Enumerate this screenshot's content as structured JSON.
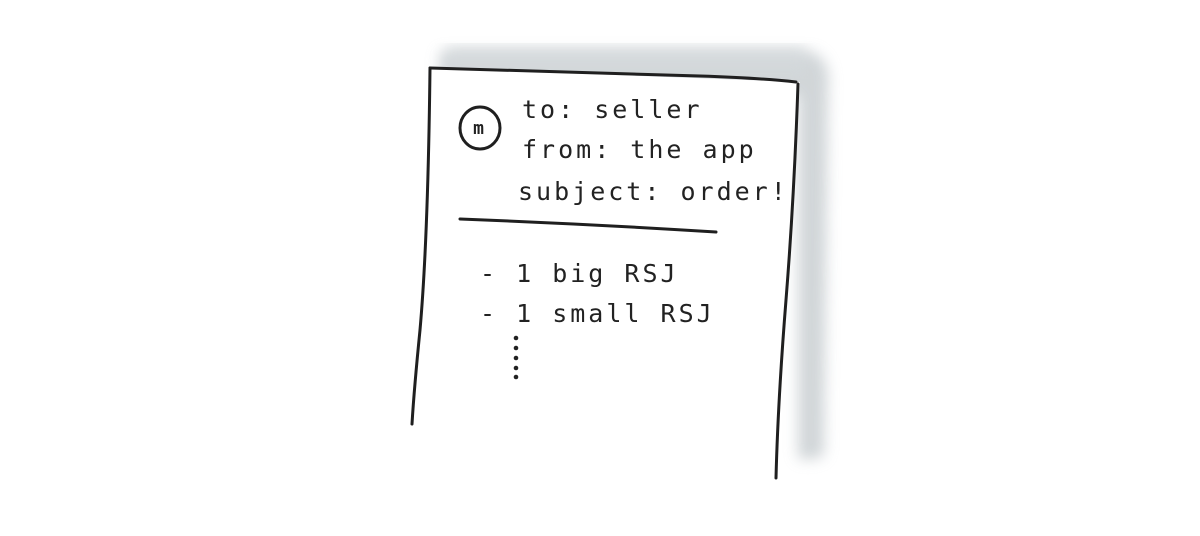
{
  "email": {
    "avatar_letter": "m",
    "to_line": "to: seller",
    "from_line": "from: the app",
    "subject_line": "subject: order!",
    "items": [
      "- 1 big RSJ",
      "- 1 small RSJ"
    ],
    "continuation": "⋮"
  },
  "colors": {
    "ink": "#1f1f1f",
    "shadow": "#c9cfd2",
    "paper": "#ffffff"
  },
  "icons": {
    "avatar": "circled-m-icon"
  }
}
